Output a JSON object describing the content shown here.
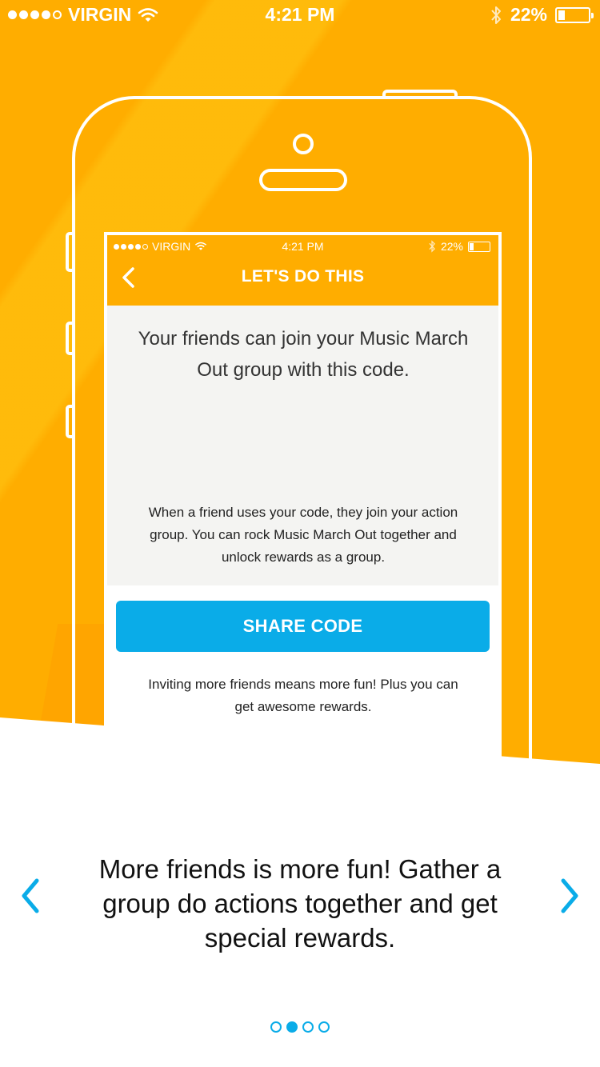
{
  "status_bar": {
    "carrier": "VIRGIN",
    "time": "4:21 PM",
    "battery": "22%",
    "battery_level": 0.22,
    "signal_dots_filled": 4,
    "signal_dots_total": 5,
    "icons": [
      "wifi-icon",
      "bluetooth-icon",
      "battery-icon"
    ]
  },
  "mockup": {
    "status_bar": {
      "carrier": "VIRGIN",
      "time": "4:21 PM",
      "battery": "22%"
    },
    "header": {
      "title": "LET'S DO THIS",
      "back_icon": "chevron-left-icon"
    },
    "code_heading": "Your friends can join your Music March Out group with this code.",
    "code_description": "When a friend uses your code, they join your action group. You can rock Music March Out together and unlock rewards as a group.",
    "share_button": "SHARE CODE",
    "invite_text": "Inviting more friends means more fun! Plus you can get awesome rewards."
  },
  "caption": "More friends is more fun! Gather a group do actions together and get special rewards.",
  "navigation": {
    "prev_icon": "chevron-left-icon",
    "next_icon": "chevron-right-icon"
  },
  "pager": {
    "total": 4,
    "active_index": 1
  },
  "colors": {
    "orange": "#FFAD00",
    "blue": "#0AACE8",
    "screen_bg": "#F4F4F2"
  }
}
